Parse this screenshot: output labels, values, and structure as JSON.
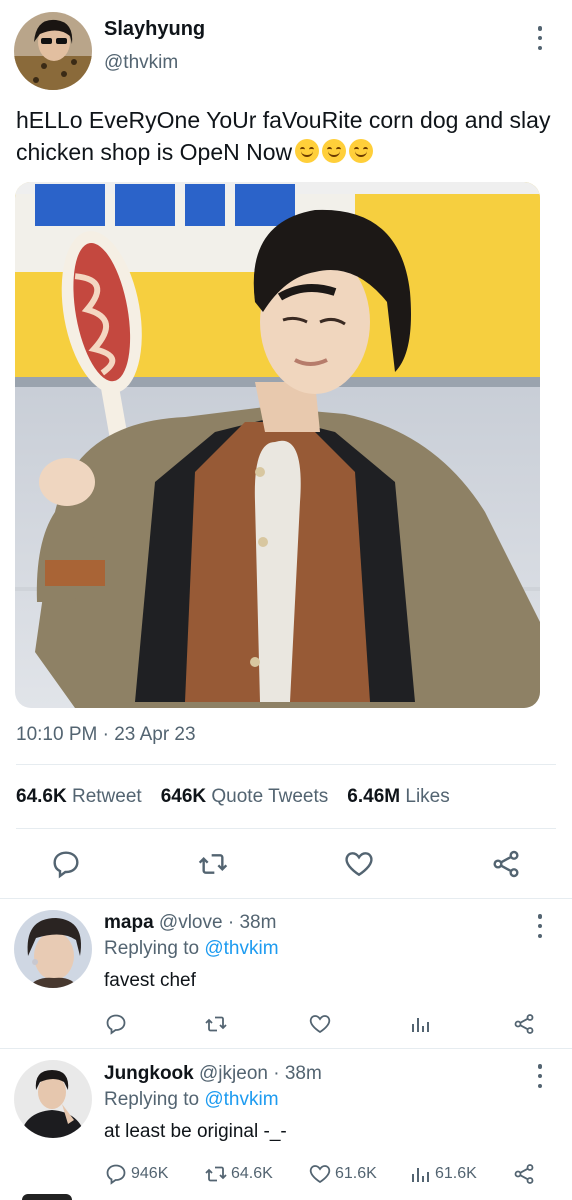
{
  "main_tweet": {
    "display_name": "Slayhyung",
    "handle": "@thvkim",
    "text": "hELLo EveRyOne YoUr faVouRite corn dog and slay chicken shop is OpeN Now",
    "emoji_count": 3,
    "timestamp": "10:10 PM · 23 Apr 23",
    "stats": {
      "retweets_num": "64.6K",
      "retweets_label": "Retweet",
      "quotes_num": "646K",
      "quotes_label": "Quote Tweets",
      "likes_num": "6.46M",
      "likes_label": "Likes"
    },
    "actions": [
      "reply-icon",
      "retweet-icon",
      "heart-icon",
      "share-icon"
    ]
  },
  "replies": [
    {
      "display_name": "mapa",
      "handle": "@vlove",
      "time": "· 38m",
      "replying_prefix": "Replying to",
      "replying_handle": "@thvkim",
      "text": "favest chef",
      "counts": {
        "reply": "",
        "retweet": "",
        "like": "",
        "views": ""
      }
    },
    {
      "display_name": "Jungkook",
      "handle": "@jkjeon",
      "time": "· 38m",
      "replying_prefix": "Replying to",
      "replying_handle": "@thvkim",
      "text": "at least be original -_-",
      "counts": {
        "reply": "946K",
        "retweet": "64.6K",
        "like": "61.6K",
        "views": "61.6K"
      }
    }
  ],
  "colors": {
    "text": "#0f1419",
    "secondary": "#536471",
    "link": "#1d9bf0",
    "divider": "#e6ecf0"
  }
}
